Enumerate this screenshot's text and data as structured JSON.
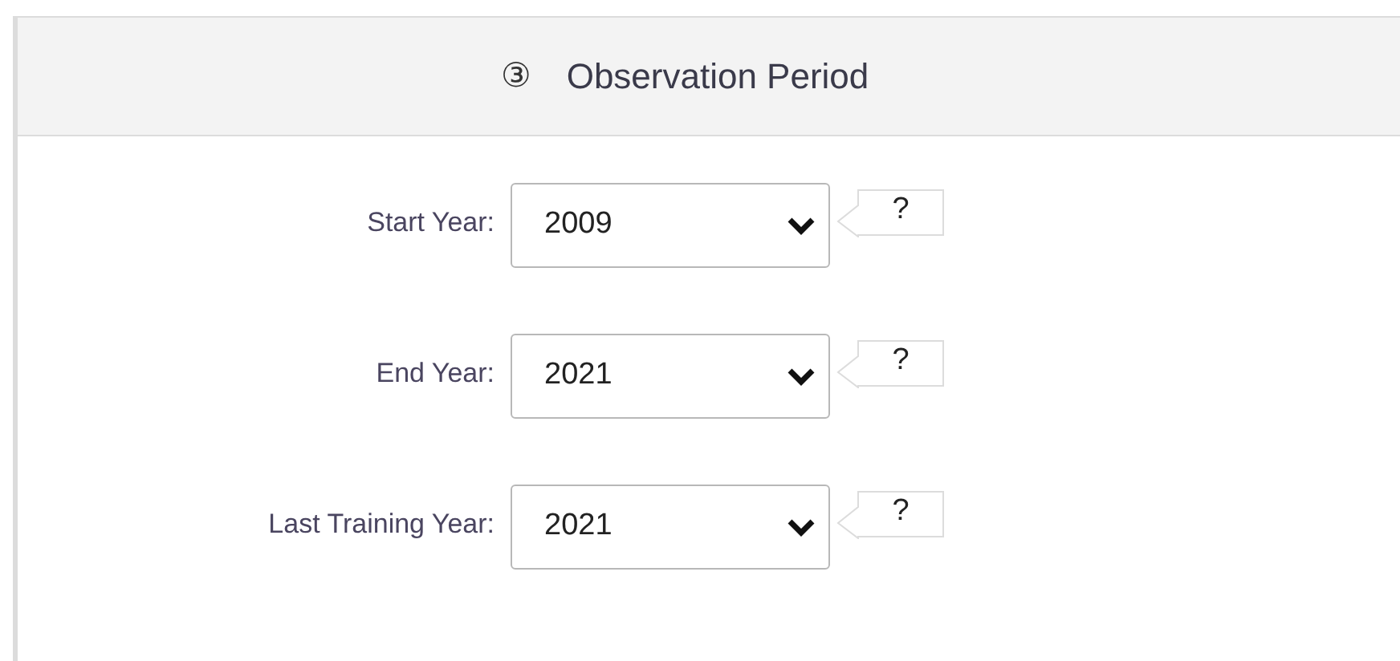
{
  "section": {
    "step": "③",
    "title": "Observation Period"
  },
  "fields": [
    {
      "label": "Start Year:",
      "value": "2009",
      "help": "?"
    },
    {
      "label": "End Year:",
      "value": "2021",
      "help": "?"
    },
    {
      "label": "Last Training Year:",
      "value": "2021",
      "help": "?"
    }
  ]
}
